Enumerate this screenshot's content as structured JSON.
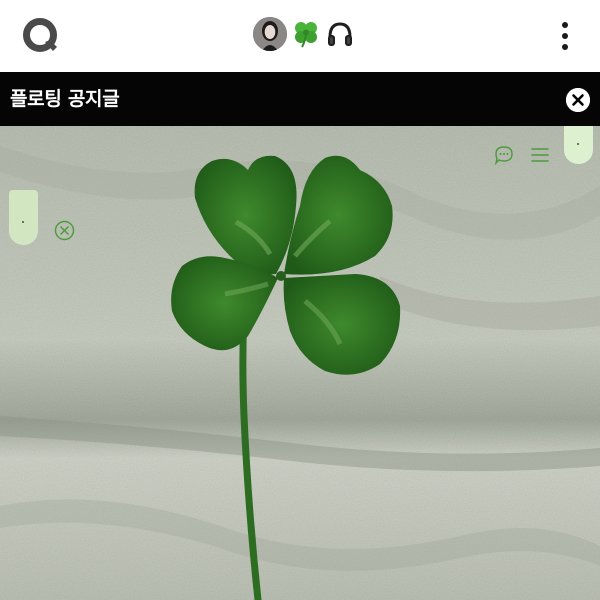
{
  "header": {
    "logo_icon": "q-logo-icon",
    "profile_avatar": "user-avatar",
    "profile_emojis": [
      "four-leaf-clover-icon",
      "headphones-icon"
    ],
    "menu_icon": "kebab-menu-icon"
  },
  "notice": {
    "title": "플로팅 공지글",
    "close_icon": "close-circle-icon"
  },
  "floating_widgets": {
    "left_tab_icon": "pull-tab",
    "left_button_icon": "close-circle-icon",
    "chat_icon": "chat-bubble-icon",
    "list_icon": "list-icon",
    "right_tab_icon": "pull-tab"
  },
  "colors": {
    "header_bg": "#ffffff",
    "notice_bg": "#050505",
    "notice_text": "#ffffff",
    "accent_green": "#4c9a3a",
    "tab_green": "#d3e6c2"
  }
}
